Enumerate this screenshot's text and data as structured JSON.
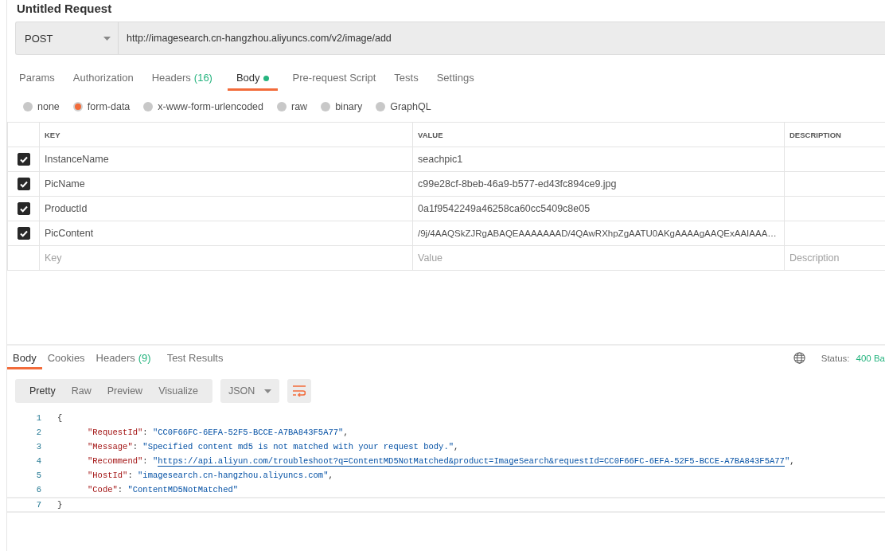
{
  "title": "Untitled Request",
  "request": {
    "method": "POST",
    "url": "http://imagesearch.cn-hangzhou.aliyuncs.com/v2/image/add"
  },
  "tabs": [
    {
      "label": "Params",
      "selected": false
    },
    {
      "label": "Authorization",
      "selected": false
    },
    {
      "label": "Headers",
      "count": "(16)",
      "selected": false
    },
    {
      "label": "Body",
      "dot": true,
      "selected": true
    },
    {
      "label": "Pre-request Script",
      "selected": false
    },
    {
      "label": "Tests",
      "selected": false
    },
    {
      "label": "Settings",
      "selected": false
    }
  ],
  "body_types": [
    {
      "label": "none",
      "selected": false
    },
    {
      "label": "form-data",
      "selected": true
    },
    {
      "label": "x-www-form-urlencoded",
      "selected": false
    },
    {
      "label": "raw",
      "selected": false
    },
    {
      "label": "binary",
      "selected": false
    },
    {
      "label": "GraphQL",
      "selected": false
    }
  ],
  "params_table": {
    "columns": [
      "KEY",
      "VALUE",
      "DESCRIPTION"
    ],
    "rows": [
      {
        "checked": true,
        "key": "InstanceName",
        "value": "seachpic1"
      },
      {
        "checked": true,
        "key": "PicName",
        "value": "c99e28cf-8beb-46a9-b577-ed43fc894ce9.jpg"
      },
      {
        "checked": true,
        "key": "ProductId",
        "value": "0a1f9542249a46258ca60cc5409c8e05"
      },
      {
        "checked": true,
        "key": "PicContent",
        "value": "/9j/4AAQSkZJRgABAQEAAAAAAAD/4QAwRXhpZgAATU0AKgAAAAgAAQExAAIAAA…"
      }
    ],
    "new_row": {
      "key_placeholder": "Key",
      "value_placeholder": "Value",
      "description_placeholder": "Description"
    }
  },
  "response": {
    "tabs": [
      {
        "label": "Body",
        "selected": true
      },
      {
        "label": "Cookies",
        "selected": false
      },
      {
        "label": "Headers",
        "count": "(9)",
        "selected": false
      },
      {
        "label": "Test Results",
        "selected": false
      }
    ],
    "status_label": "Status:",
    "status": "400 Ba",
    "view_modes": [
      {
        "label": "Pretty",
        "selected": true
      },
      {
        "label": "Raw",
        "selected": false
      },
      {
        "label": "Preview",
        "selected": false
      },
      {
        "label": "Visualize",
        "selected": false
      }
    ],
    "format": "JSON",
    "code_lines": [
      {
        "number": "1",
        "nested": false,
        "current": false,
        "tokens": [
          {
            "kind": "punct",
            "text": "{"
          }
        ]
      },
      {
        "number": "2",
        "nested": true,
        "current": false,
        "tokens": [
          {
            "kind": "key",
            "text": "\"RequestId\""
          },
          {
            "kind": "punct",
            "text": ": "
          },
          {
            "kind": "string",
            "text": "\"CC0F66FC-6EFA-52F5-BCCE-A7BA843F5A77\""
          },
          {
            "kind": "punct",
            "text": ","
          }
        ]
      },
      {
        "number": "3",
        "nested": true,
        "current": false,
        "tokens": [
          {
            "kind": "key",
            "text": "\"Message\""
          },
          {
            "kind": "punct",
            "text": ": "
          },
          {
            "kind": "string",
            "text": "\"Specified content md5 is not matched with your request body.\""
          },
          {
            "kind": "punct",
            "text": ","
          }
        ]
      },
      {
        "number": "4",
        "nested": true,
        "current": false,
        "tokens": [
          {
            "kind": "key",
            "text": "\"Recommend\""
          },
          {
            "kind": "punct",
            "text": ": "
          },
          {
            "kind": "string",
            "text": "\""
          },
          {
            "kind": "link",
            "text": "https://api.aliyun.com/troubleshoot?q=ContentMD5NotMatched&product=ImageSearch&requestId=CC0F66FC-6EFA-52F5-BCCE-A7BA843F5A77"
          },
          {
            "kind": "string",
            "text": "\""
          },
          {
            "kind": "punct",
            "text": ","
          }
        ]
      },
      {
        "number": "5",
        "nested": true,
        "current": false,
        "tokens": [
          {
            "kind": "key",
            "text": "\"HostId\""
          },
          {
            "kind": "punct",
            "text": ": "
          },
          {
            "kind": "string",
            "text": "\"imagesearch.cn-hangzhou.aliyuncs.com\""
          },
          {
            "kind": "punct",
            "text": ","
          }
        ]
      },
      {
        "number": "6",
        "nested": true,
        "current": false,
        "tokens": [
          {
            "kind": "key",
            "text": "\"Code\""
          },
          {
            "kind": "punct",
            "text": ": "
          },
          {
            "kind": "string",
            "text": "\"ContentMD5NotMatched\""
          }
        ]
      },
      {
        "number": "7",
        "nested": false,
        "current": true,
        "tokens": [
          {
            "kind": "punct",
            "text": "}"
          }
        ]
      }
    ]
  }
}
